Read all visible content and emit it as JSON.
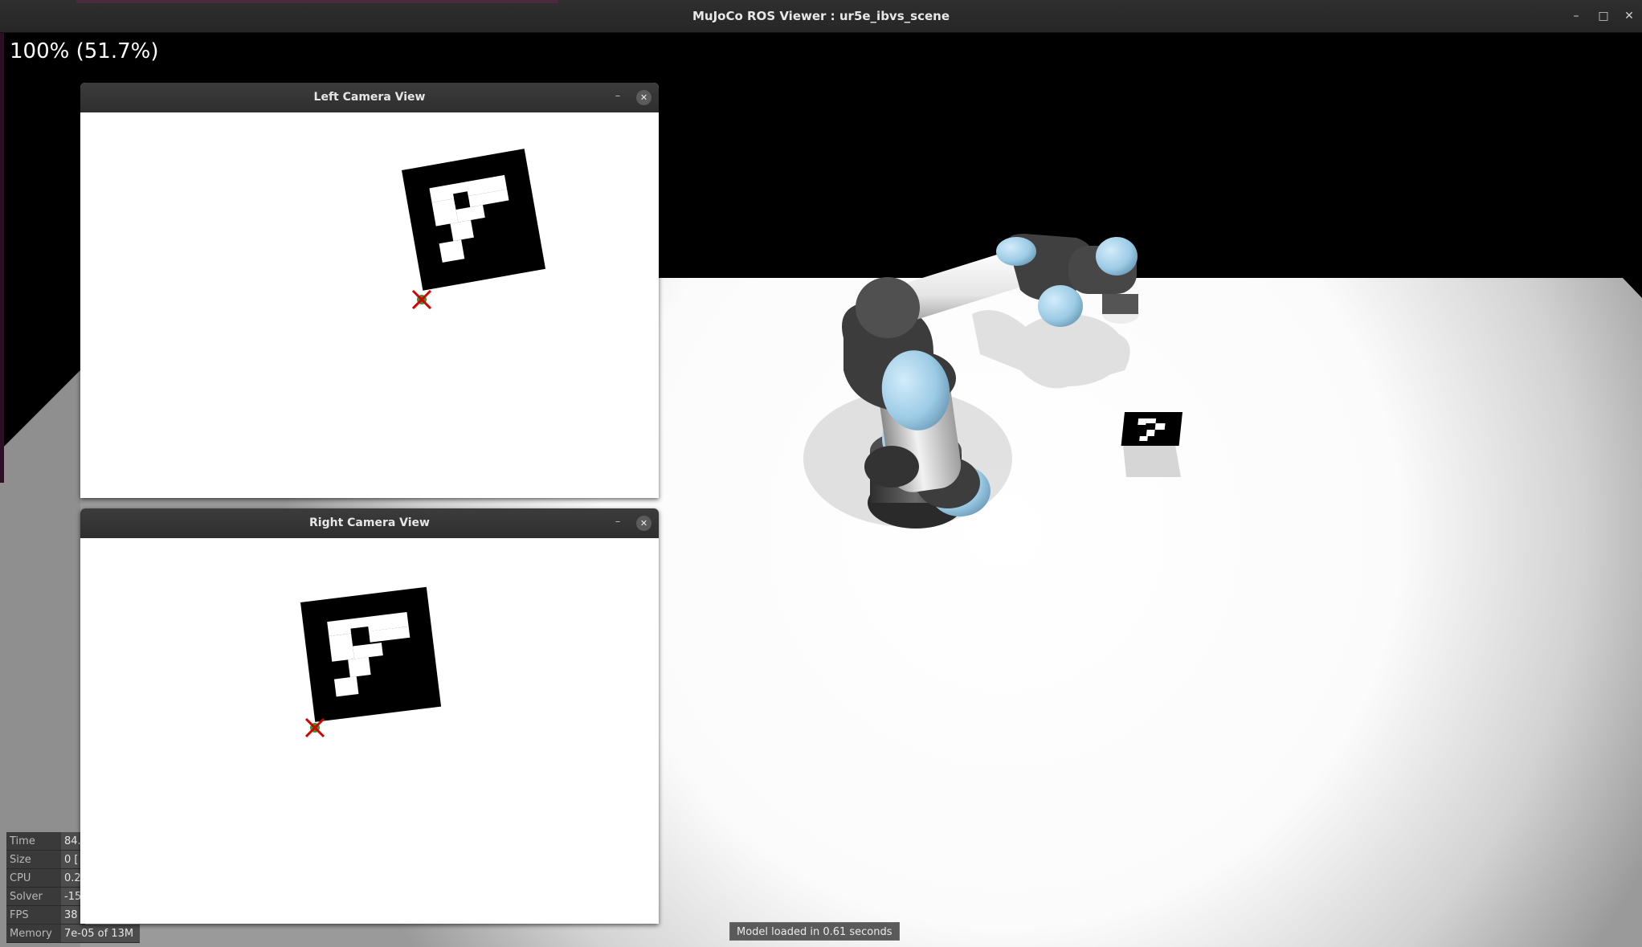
{
  "window": {
    "title": "MuJoCo ROS Viewer : ur5e_ibvs_scene",
    "controls": {
      "minimize": "–",
      "maximize": "□",
      "close": "✕"
    }
  },
  "viewport": {
    "zoom_readout": "100% (51.7%)",
    "status_message": "Model loaded in 0.61 seconds"
  },
  "info_panel": {
    "rows": [
      {
        "label": "Time",
        "value": "84."
      },
      {
        "label": "Size",
        "value": "0  ["
      },
      {
        "label": "CPU",
        "value": "0.2"
      },
      {
        "label": "Solver",
        "value": "-15"
      },
      {
        "label": "FPS",
        "value": "38"
      },
      {
        "label": "Memory",
        "value": "7e-05 of 13M"
      }
    ]
  },
  "left_camera": {
    "title": "Left Camera View",
    "minimize": "–",
    "close": "✕",
    "marker_color": "#d40000",
    "corner_color": "#2e9b2e"
  },
  "right_camera": {
    "title": "Right Camera View",
    "minimize": "–",
    "close": "✕",
    "marker_color": "#d40000",
    "corner_color": "#2e9b2e"
  },
  "colors": {
    "robot_joint_cap": "#9ccbe6",
    "robot_link_dark": "#4a4a4a",
    "robot_link_light": "#e8e8e8",
    "floor": "#ffffff",
    "sky": "#000000"
  },
  "icons": {
    "minimize": "minimize-icon",
    "maximize": "maximize-icon",
    "close": "close-icon"
  }
}
